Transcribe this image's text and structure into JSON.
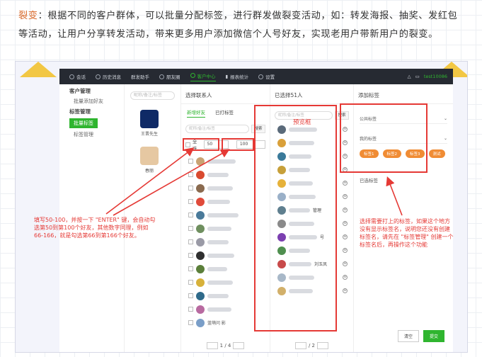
{
  "intro": {
    "highlight": "裂变",
    "text": "：根据不同的客户群体，可以批量分配标签，进行群发做裂变活动，如：转发海报、抽奖、发红包等活动，让用户分享转发活动，带来更多用户添加微信个人号好友，实现老用户带新用户的裂变。"
  },
  "nav": {
    "items": [
      "会话",
      "历史消息",
      "群发助手",
      "朋友圈",
      "客户中心",
      "报表统计",
      "设置"
    ],
    "active": "客户中心",
    "user": "test10086"
  },
  "sidebar": {
    "group1": "客户管理",
    "item1": "批量添加好友",
    "group2": "标签管理",
    "item2": "批量标签",
    "item3": "标签管理"
  },
  "accounts": {
    "search_placeholder": "昵称/备注/标签",
    "list": [
      {
        "name": "王晋先生"
      },
      {
        "name": "春丽"
      }
    ]
  },
  "col1": {
    "title": "选择联系人",
    "tabs": [
      "新增好友",
      "已打标签"
    ],
    "search_placeholder": "昵称/备注/标签",
    "search_btn": "搜索",
    "select_all": "全选",
    "from": "50",
    "to": "100",
    "pager": "1 / 4",
    "last_name": "蓝萌问 影"
  },
  "col2": {
    "title": "已选择51人",
    "search_placeholder": "昵称/备注/标签",
    "search_btn": "搜索",
    "pager": "/ 2",
    "name1": "管理",
    "name2": "号",
    "name3": "刘玉凤"
  },
  "col3": {
    "title": "添加标签",
    "dd1": "公共标签",
    "dd2": "我的标签",
    "chips": [
      "标签1",
      "标签2",
      "标签3",
      "测试"
    ],
    "selected": "已选标签",
    "clear": "清空",
    "submit": "提交"
  },
  "annotations": {
    "left": "填写50-100，并按一下 \"ENTER\" 键，会自动勾选第50到第100个好友，其他数字同理，例如66-166，就是勾选第66到第166个好友。",
    "preview": "预览框",
    "right": "选择需要打上的标签，如果这个地方没有显示标签名，说明您还没有创建标签名，请先在 \"标签管理\" 创建一个标签名后，再操作这个功能"
  },
  "colors": {
    "accent": "#2fb52f",
    "annotation": "#e53935",
    "highlight": "#d9682a",
    "chip": "#f08c34"
  }
}
